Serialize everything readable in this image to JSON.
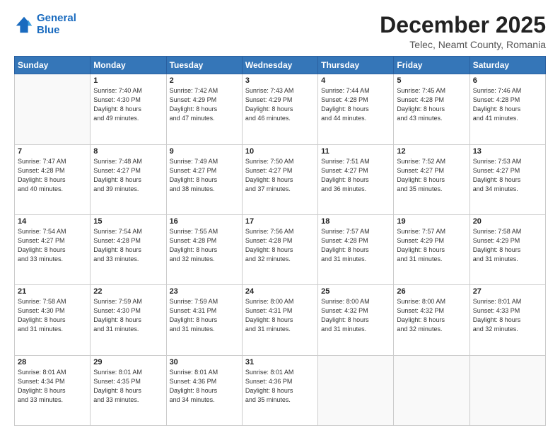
{
  "header": {
    "logo_line1": "General",
    "logo_line2": "Blue",
    "month_title": "December 2025",
    "subtitle": "Telec, Neamt County, Romania"
  },
  "days_of_week": [
    "Sunday",
    "Monday",
    "Tuesday",
    "Wednesday",
    "Thursday",
    "Friday",
    "Saturday"
  ],
  "weeks": [
    [
      {
        "day": "",
        "info": ""
      },
      {
        "day": "1",
        "info": "Sunrise: 7:40 AM\nSunset: 4:30 PM\nDaylight: 8 hours\nand 49 minutes."
      },
      {
        "day": "2",
        "info": "Sunrise: 7:42 AM\nSunset: 4:29 PM\nDaylight: 8 hours\nand 47 minutes."
      },
      {
        "day": "3",
        "info": "Sunrise: 7:43 AM\nSunset: 4:29 PM\nDaylight: 8 hours\nand 46 minutes."
      },
      {
        "day": "4",
        "info": "Sunrise: 7:44 AM\nSunset: 4:28 PM\nDaylight: 8 hours\nand 44 minutes."
      },
      {
        "day": "5",
        "info": "Sunrise: 7:45 AM\nSunset: 4:28 PM\nDaylight: 8 hours\nand 43 minutes."
      },
      {
        "day": "6",
        "info": "Sunrise: 7:46 AM\nSunset: 4:28 PM\nDaylight: 8 hours\nand 41 minutes."
      }
    ],
    [
      {
        "day": "7",
        "info": "Sunrise: 7:47 AM\nSunset: 4:28 PM\nDaylight: 8 hours\nand 40 minutes."
      },
      {
        "day": "8",
        "info": "Sunrise: 7:48 AM\nSunset: 4:27 PM\nDaylight: 8 hours\nand 39 minutes."
      },
      {
        "day": "9",
        "info": "Sunrise: 7:49 AM\nSunset: 4:27 PM\nDaylight: 8 hours\nand 38 minutes."
      },
      {
        "day": "10",
        "info": "Sunrise: 7:50 AM\nSunset: 4:27 PM\nDaylight: 8 hours\nand 37 minutes."
      },
      {
        "day": "11",
        "info": "Sunrise: 7:51 AM\nSunset: 4:27 PM\nDaylight: 8 hours\nand 36 minutes."
      },
      {
        "day": "12",
        "info": "Sunrise: 7:52 AM\nSunset: 4:27 PM\nDaylight: 8 hours\nand 35 minutes."
      },
      {
        "day": "13",
        "info": "Sunrise: 7:53 AM\nSunset: 4:27 PM\nDaylight: 8 hours\nand 34 minutes."
      }
    ],
    [
      {
        "day": "14",
        "info": "Sunrise: 7:54 AM\nSunset: 4:27 PM\nDaylight: 8 hours\nand 33 minutes."
      },
      {
        "day": "15",
        "info": "Sunrise: 7:54 AM\nSunset: 4:28 PM\nDaylight: 8 hours\nand 33 minutes."
      },
      {
        "day": "16",
        "info": "Sunrise: 7:55 AM\nSunset: 4:28 PM\nDaylight: 8 hours\nand 32 minutes."
      },
      {
        "day": "17",
        "info": "Sunrise: 7:56 AM\nSunset: 4:28 PM\nDaylight: 8 hours\nand 32 minutes."
      },
      {
        "day": "18",
        "info": "Sunrise: 7:57 AM\nSunset: 4:28 PM\nDaylight: 8 hours\nand 31 minutes."
      },
      {
        "day": "19",
        "info": "Sunrise: 7:57 AM\nSunset: 4:29 PM\nDaylight: 8 hours\nand 31 minutes."
      },
      {
        "day": "20",
        "info": "Sunrise: 7:58 AM\nSunset: 4:29 PM\nDaylight: 8 hours\nand 31 minutes."
      }
    ],
    [
      {
        "day": "21",
        "info": "Sunrise: 7:58 AM\nSunset: 4:30 PM\nDaylight: 8 hours\nand 31 minutes."
      },
      {
        "day": "22",
        "info": "Sunrise: 7:59 AM\nSunset: 4:30 PM\nDaylight: 8 hours\nand 31 minutes."
      },
      {
        "day": "23",
        "info": "Sunrise: 7:59 AM\nSunset: 4:31 PM\nDaylight: 8 hours\nand 31 minutes."
      },
      {
        "day": "24",
        "info": "Sunrise: 8:00 AM\nSunset: 4:31 PM\nDaylight: 8 hours\nand 31 minutes."
      },
      {
        "day": "25",
        "info": "Sunrise: 8:00 AM\nSunset: 4:32 PM\nDaylight: 8 hours\nand 31 minutes."
      },
      {
        "day": "26",
        "info": "Sunrise: 8:00 AM\nSunset: 4:32 PM\nDaylight: 8 hours\nand 32 minutes."
      },
      {
        "day": "27",
        "info": "Sunrise: 8:01 AM\nSunset: 4:33 PM\nDaylight: 8 hours\nand 32 minutes."
      }
    ],
    [
      {
        "day": "28",
        "info": "Sunrise: 8:01 AM\nSunset: 4:34 PM\nDaylight: 8 hours\nand 33 minutes."
      },
      {
        "day": "29",
        "info": "Sunrise: 8:01 AM\nSunset: 4:35 PM\nDaylight: 8 hours\nand 33 minutes."
      },
      {
        "day": "30",
        "info": "Sunrise: 8:01 AM\nSunset: 4:36 PM\nDaylight: 8 hours\nand 34 minutes."
      },
      {
        "day": "31",
        "info": "Sunrise: 8:01 AM\nSunset: 4:36 PM\nDaylight: 8 hours\nand 35 minutes."
      },
      {
        "day": "",
        "info": ""
      },
      {
        "day": "",
        "info": ""
      },
      {
        "day": "",
        "info": ""
      }
    ]
  ]
}
